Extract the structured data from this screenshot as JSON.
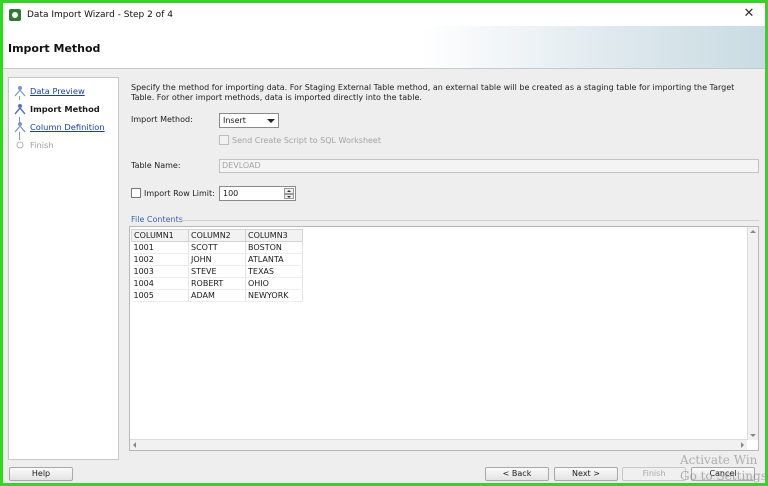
{
  "window": {
    "title": "Data Import Wizard - Step 2 of 4",
    "close_glyph": "✕"
  },
  "header": {
    "title": "Import Method"
  },
  "steps": [
    {
      "label": "Data Preview",
      "state": "link"
    },
    {
      "label": "Import Method",
      "state": "current"
    },
    {
      "label": "Column Definition",
      "state": "link"
    },
    {
      "label": "Finish",
      "state": "disabled"
    }
  ],
  "main": {
    "description": "Specify the method for importing data.  For Staging External Table method, an external table will be created as a staging table for importing the Target Table.  For other import methods, data is imported directly into the table.",
    "import_method": {
      "label": "Import Method:",
      "value": "Insert"
    },
    "send_script": {
      "label": "Send Create Script to SQL Worksheet",
      "checked": false,
      "enabled": false
    },
    "table_name": {
      "label": "Table Name:",
      "value": "DEVLOAD"
    },
    "import_row_limit": {
      "label": "Import Row Limit:",
      "checked": false,
      "value": "100"
    },
    "file_contents": {
      "label": "File Contents",
      "columns": [
        "COLUMN1",
        "COLUMN2",
        "COLUMN3"
      ],
      "rows": [
        [
          "1001",
          "SCOTT",
          "BOSTON"
        ],
        [
          "1002",
          "JOHN",
          "ATLANTA"
        ],
        [
          "1003",
          "STEVE",
          "TEXAS"
        ],
        [
          "1004",
          "ROBERT",
          "OHIO"
        ],
        [
          "1005",
          "ADAM",
          "NEWYORK"
        ]
      ]
    }
  },
  "footer": {
    "help": "Help",
    "back": "< Back",
    "next": "Next >",
    "finish": "Finish",
    "cancel": "Cancel"
  },
  "watermark": {
    "line1": "Activate Win",
    "line2": "Go to Settings to"
  },
  "colors": {
    "frame": "#3bd12b",
    "link": "#1d3f9b",
    "group_label": "#3c5fa8"
  },
  "icons": {
    "close": "close-icon",
    "app": "app-icon",
    "step": "step-person-icon"
  }
}
